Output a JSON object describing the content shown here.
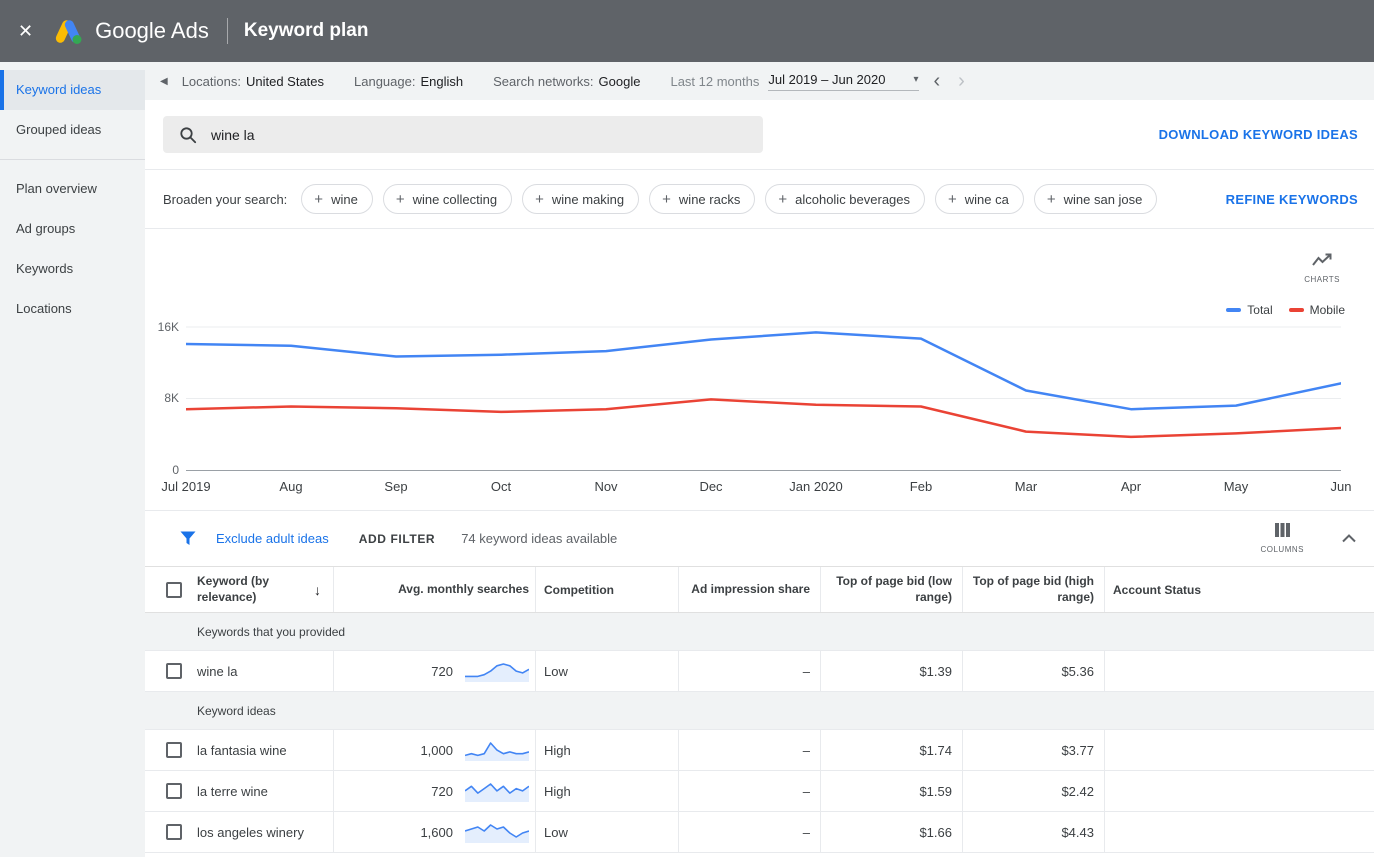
{
  "topbar": {
    "brand": "Google Ads",
    "title": "Keyword plan"
  },
  "sidebar": {
    "items": [
      "Keyword ideas",
      "Grouped ideas",
      "Plan overview",
      "Ad groups",
      "Keywords",
      "Locations"
    ]
  },
  "settings": {
    "locations_label": "Locations:",
    "locations_value": "United States",
    "language_label": "Language:",
    "language_value": "English",
    "networks_label": "Search networks:",
    "networks_value": "Google",
    "range_label": "Last 12 months",
    "range_value": "Jul 2019 – Jun 2020"
  },
  "search": {
    "query": "wine la",
    "download_label": "DOWNLOAD KEYWORD IDEAS"
  },
  "broaden": {
    "label": "Broaden your search:",
    "chips": [
      "wine",
      "wine collecting",
      "wine making",
      "wine racks",
      "alcoholic beverages",
      "wine ca",
      "wine san jose"
    ],
    "refine_label": "REFINE KEYWORDS"
  },
  "chart_ui": {
    "charts_label": "CHARTS"
  },
  "chart_data": {
    "type": "line",
    "title": "",
    "x": [
      "Jul 2019",
      "Aug",
      "Sep",
      "Oct",
      "Nov",
      "Dec",
      "Jan 2020",
      "Feb",
      "Mar",
      "Apr",
      "May",
      "Jun"
    ],
    "series": [
      {
        "name": "Total",
        "color": "#4285f4",
        "values": [
          14100,
          13900,
          12700,
          12900,
          13300,
          14600,
          15400,
          14700,
          8900,
          6800,
          7200,
          9700
        ]
      },
      {
        "name": "Mobile",
        "color": "#ea4335",
        "values": [
          6800,
          7100,
          6900,
          6500,
          6800,
          7900,
          7300,
          7100,
          4300,
          3700,
          4100,
          4700
        ]
      }
    ],
    "ylim": [
      0,
      16000
    ],
    "yticks": [
      "0",
      "8K",
      "16K"
    ],
    "grid": true,
    "legend_position": "top-right"
  },
  "filters": {
    "exclude_label": "Exclude adult ideas",
    "add_filter_label": "ADD FILTER",
    "available_text": "74 keyword ideas available",
    "columns_label": "COLUMNS"
  },
  "table": {
    "headers": [
      "Keyword (by relevance)",
      "Avg. monthly searches",
      "Competition",
      "Ad impression share",
      "Top of page bid (low range)",
      "Top of page bid (high range)",
      "Account Status"
    ],
    "sections": [
      {
        "title": "Keywords that you provided",
        "rows": [
          {
            "keyword": "wine la",
            "searches": "720",
            "spark": [
              2,
              2,
              2,
              3,
              5,
              8,
              9,
              8,
              5,
              4,
              6
            ],
            "competition": "Low",
            "impression": "–",
            "bid_low": "$1.39",
            "bid_high": "$5.36",
            "status": ""
          }
        ]
      },
      {
        "title": "Keyword ideas",
        "rows": [
          {
            "keyword": "la fantasia wine",
            "searches": "1,000",
            "spark": [
              2,
              3,
              2,
              3,
              9,
              5,
              3,
              4,
              3,
              3,
              4
            ],
            "competition": "High",
            "impression": "–",
            "bid_low": "$1.74",
            "bid_high": "$3.77",
            "status": ""
          },
          {
            "keyword": "la terre wine",
            "searches": "720",
            "spark": [
              4,
              6,
              3,
              5,
              7,
              4,
              6,
              3,
              5,
              4,
              6
            ],
            "competition": "High",
            "impression": "–",
            "bid_low": "$1.59",
            "bid_high": "$2.42",
            "status": ""
          },
          {
            "keyword": "los angeles winery",
            "searches": "1,600",
            "spark": [
              5,
              6,
              7,
              5,
              8,
              6,
              7,
              4,
              2,
              4,
              5
            ],
            "competition": "Low",
            "impression": "–",
            "bid_low": "$1.66",
            "bid_high": "$4.43",
            "status": ""
          }
        ]
      }
    ]
  },
  "colors": {
    "accent": "#1a73e8",
    "total_line": "#4285f4",
    "mobile_line": "#ea4335",
    "topbar_bg": "#5f6368"
  }
}
